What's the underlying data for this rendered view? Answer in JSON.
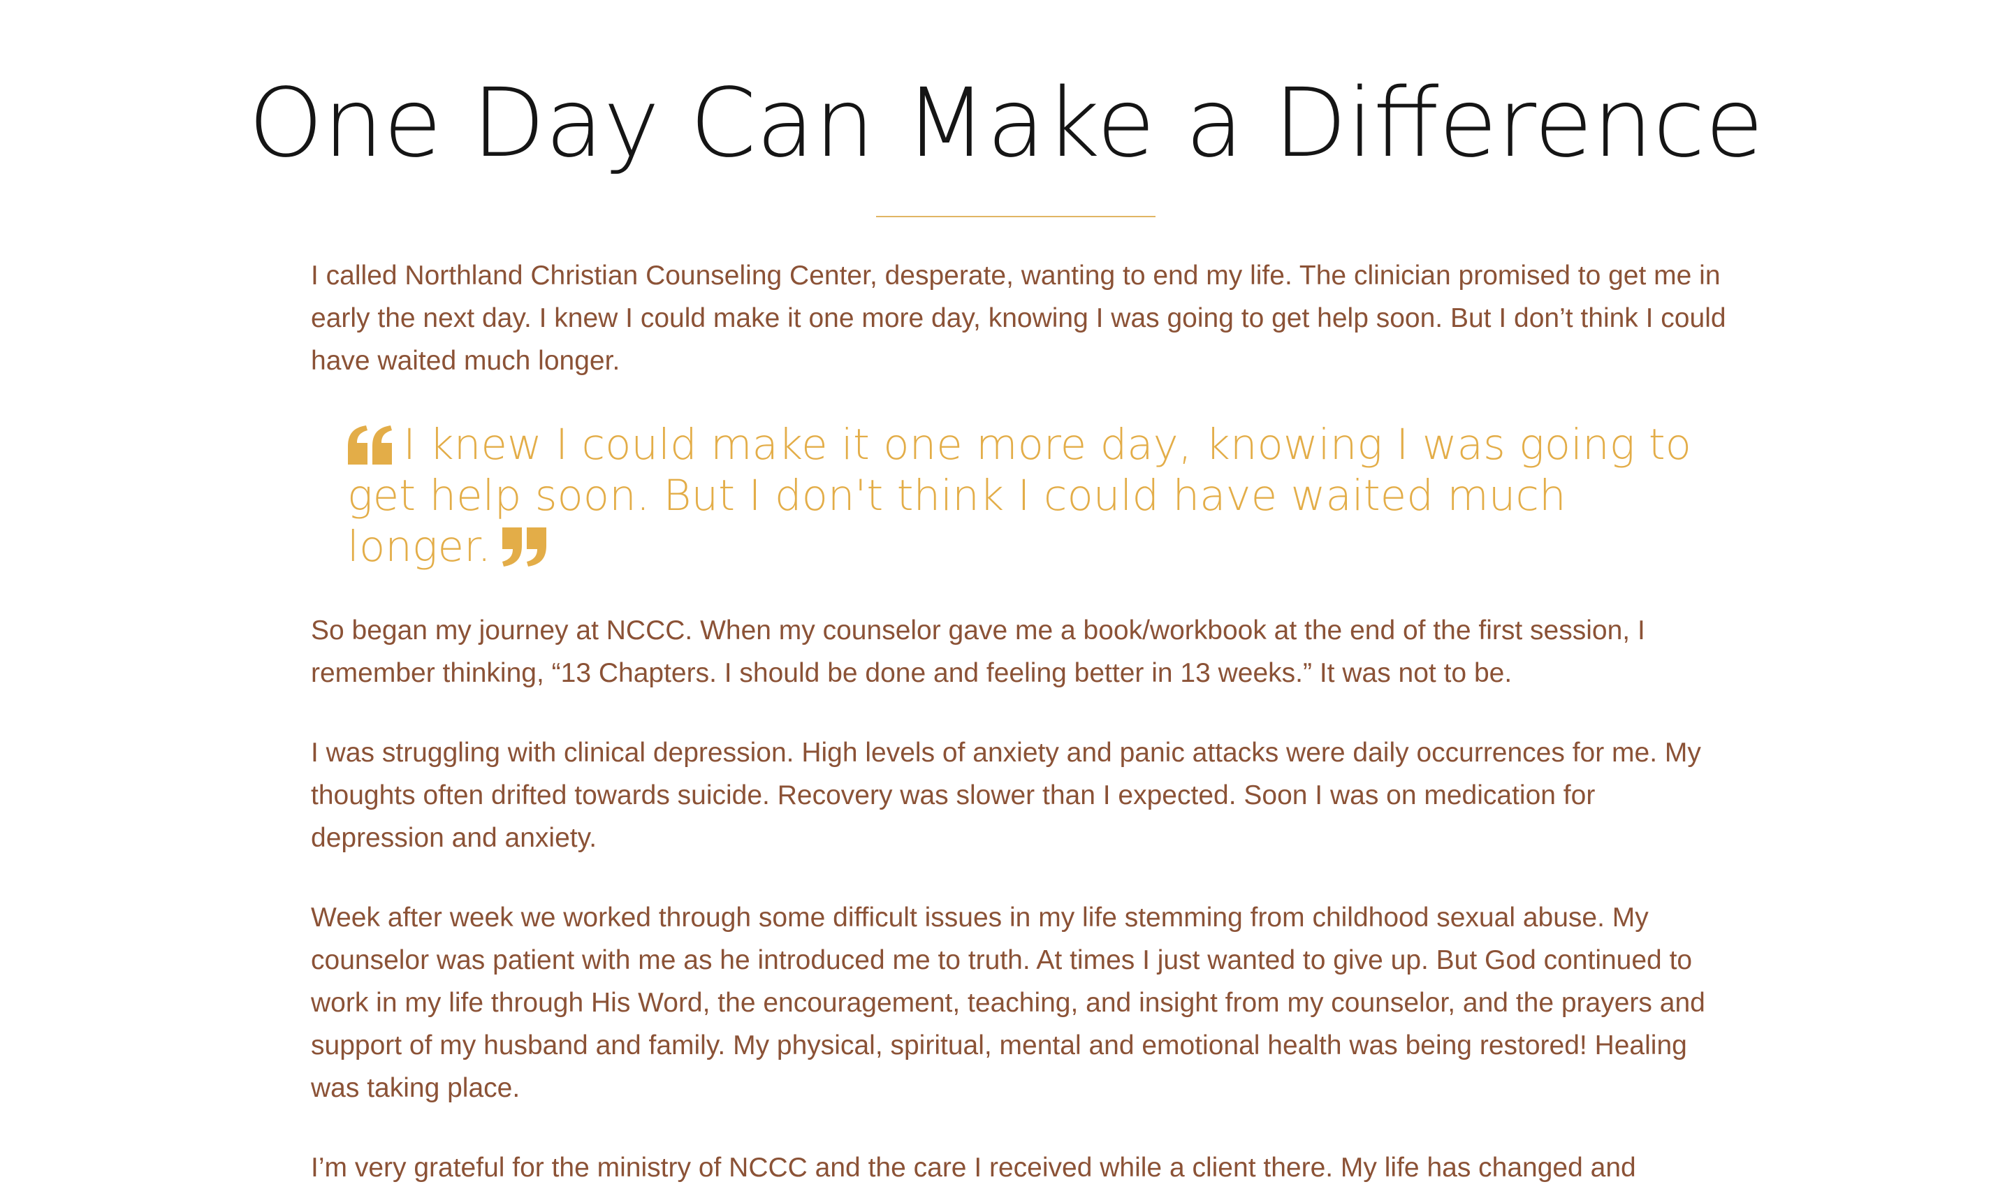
{
  "article": {
    "title": "One Day Can Make a Difference",
    "paragraphs": [
      "I called Northland Christian Counseling Center, desperate, wanting to end my life. The clinician promised to get me in early the next day. I knew I could make it one more day, knowing I was going to get help soon. But I don’t think I could have waited much longer.",
      "So began my journey at NCCC. When my counselor gave me a book/workbook at the end of the first session, I remember thinking, “13 Chapters. I should be done and feeling better in 13 weeks.” It was not to be.",
      "I was struggling with clinical depression. High levels of anxiety and panic attacks were daily occurrences for me. My thoughts often drifted towards suicide. Recovery was slower than I expected. Soon I was on medication for depression and anxiety.",
      "Week after week we worked through some difficult issues in my life stemming from childhood sexual abuse. My counselor was patient with me as he introduced me to truth. At times I just wanted to give up. But God continued to work in my life through His Word, the encouragement, teaching, and insight from my counselor, and the prayers and support of my husband and family. My physical, spiritual, mental and emotional health was being restored! Healing was taking place.",
      "I’m very grateful for the ministry of NCCC and the care I received while a client there. My life has changed and"
    ],
    "pullquote": "I knew I could make it one more day, knowing I was going to get help soon. But I don't think I could have waited much longer.",
    "pullquote_icons": {
      "open": "quote-open-icon",
      "close": "quote-close-icon"
    }
  },
  "colors": {
    "title": "#151515",
    "body_text": "#8b5236",
    "accent": "#e3ad48",
    "divider": "#e1b564",
    "background": "#ffffff"
  }
}
